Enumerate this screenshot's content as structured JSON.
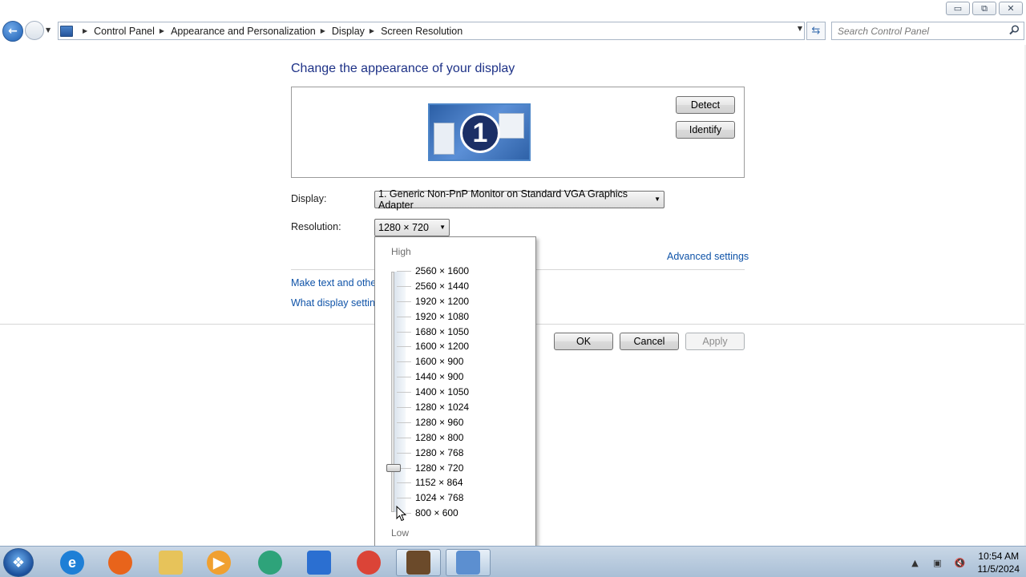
{
  "window": {
    "controls": {
      "minimize": "▭",
      "maximize": "⧉",
      "close": "✕"
    }
  },
  "addressbar": {
    "breadcrumbs": [
      "Control Panel",
      "Appearance and Personalization",
      "Display",
      "Screen Resolution"
    ],
    "search_placeholder": "Search Control Panel"
  },
  "main": {
    "title": "Change the appearance of your display",
    "monitor_number": "1",
    "detect_label": "Detect",
    "identify_label": "Identify",
    "display_label": "Display:",
    "display_value": "1. Generic Non-PnP Monitor on Standard VGA Graphics Adapter",
    "resolution_label": "Resolution:",
    "resolution_value": "1280 × 720",
    "advanced_link": "Advanced settings",
    "link_text_size": "Make text and other",
    "link_display_settings": "What display setting",
    "ok_label": "OK",
    "cancel_label": "Cancel",
    "apply_label": "Apply"
  },
  "resolution_popup": {
    "high_label": "High",
    "low_label": "Low",
    "options": [
      "2560 × 1600",
      "2560 × 1440",
      "1920 × 1200",
      "1920 × 1080",
      "1680 × 1050",
      "1600 × 1200",
      "1600 × 900",
      "1440 × 900",
      "1400 × 1050",
      "1280 × 1024",
      "1280 × 960",
      "1280 × 800",
      "1280 × 768",
      "1280 × 720",
      "1152 × 864",
      "1024 × 768",
      "800 × 600"
    ],
    "selected": "1280 × 720"
  },
  "taskbar": {
    "apps": [
      {
        "name": "internet-explorer",
        "glyph": "e",
        "color": "#1e7fd6"
      },
      {
        "name": "firefox",
        "glyph": "",
        "color": "#e8641b"
      },
      {
        "name": "file-explorer",
        "glyph": "",
        "color": "#e7c35a"
      },
      {
        "name": "media-player",
        "glyph": "▶",
        "color": "#f0a030"
      },
      {
        "name": "chat-app",
        "glyph": "",
        "color": "#2ea37a"
      },
      {
        "name": "video-editor",
        "glyph": "",
        "color": "#2b6fd1"
      },
      {
        "name": "chrome",
        "glyph": "",
        "color": "#db4437"
      },
      {
        "name": "game-app",
        "glyph": "",
        "color": "#6b4a2a"
      },
      {
        "name": "control-panel",
        "glyph": "",
        "color": "#5c8fd0"
      }
    ],
    "clock_time": "10:54 AM",
    "clock_date": "11/5/2024"
  }
}
